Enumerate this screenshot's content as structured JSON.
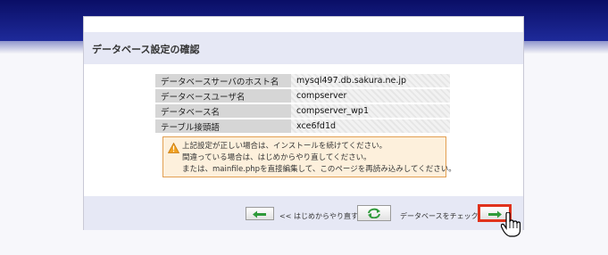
{
  "header": {
    "band_color": "#0a0e66"
  },
  "panel": {
    "title": "データベース設定の確認",
    "rows": [
      {
        "label": "データベースサーバのホスト名",
        "value": "mysql497.db.sakura.ne.jp"
      },
      {
        "label": "データベースユーザ名",
        "value": "compserver"
      },
      {
        "label": "データベース名",
        "value": "compserver_wp1"
      },
      {
        "label": "テーブル接頭語",
        "value": "xce6fd1d"
      }
    ],
    "warning": {
      "lines": [
        "上記設定が正しい場合は、インストールを続けてください。",
        "間違っている場合は、はじめからやり直してください。",
        "または、mainfile.phpを直接編集して、このページを再読み込みしてください。"
      ]
    },
    "nav": {
      "back_label": "<< はじめからやり直す",
      "check_label": "データベースをチェック >>",
      "back_icon": "arrow-left-icon",
      "reload_icon": "reload-icon",
      "next_icon": "arrow-right-icon",
      "highlight_color": "#e0321c"
    }
  }
}
